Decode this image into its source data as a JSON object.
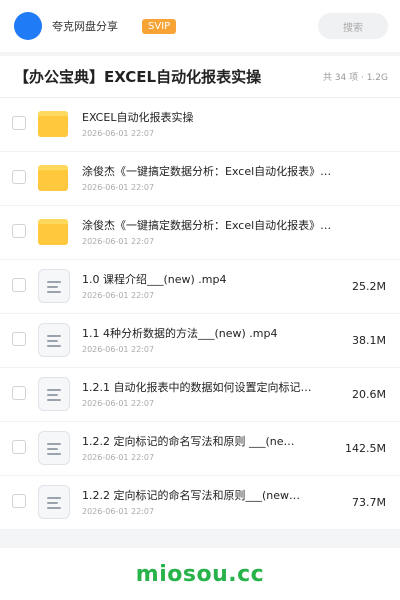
{
  "header": {
    "username": "夸克网盘分享",
    "badge": "SVIP",
    "search_placeholder": "搜索",
    "accent_color": "#1f7cf6"
  },
  "folder": {
    "title": "【办公宝典】EXCEL自动化报表实操",
    "meta": "共 34 项 · 1.2G"
  },
  "items": [
    {
      "type": "folder",
      "icon": "folder-icon",
      "name": "EXCEL自动化报表实操",
      "date": "2026-06-01 22:07",
      "size": ""
    },
    {
      "type": "folder",
      "icon": "folder-icon",
      "name": "涂俊杰《一键搞定数据分析：Excel自动化报表》资料",
      "date": "2026-06-01 22:07",
      "size": ""
    },
    {
      "type": "folder",
      "icon": "folder-icon",
      "name": "涂俊杰《一键搞定数据分析：Excel自动化报表》资料",
      "date": "2026-06-01 22:07",
      "size": ""
    },
    {
      "type": "file",
      "icon": "document-icon",
      "name": "1.0 课程介绍___(new) .mp4",
      "date": "2026-06-01 22:07",
      "size": "25.2M"
    },
    {
      "type": "file",
      "icon": "document-icon",
      "name": "1.1 4种分析数据的方法___(new) .mp4",
      "date": "2026-06-01 22:07",
      "size": "38.1M"
    },
    {
      "type": "file",
      "icon": "document-icon",
      "name": "1.2.1 自动化报表中的数据如何设置定向标记…",
      "date": "2026-06-01 22:07",
      "size": "20.6M"
    },
    {
      "type": "file",
      "icon": "document-icon",
      "name": "1.2.2 定向标记的命名写法和原则 ___(ne…",
      "date": "2026-06-01 22:07",
      "size": "142.5M"
    },
    {
      "type": "file",
      "icon": "document-icon",
      "name": "1.2.2 定向标记的命名写法和原则___(new…",
      "date": "2026-06-01 22:07",
      "size": "73.7M"
    }
  ],
  "footer": {
    "watermark": "miosou.cc",
    "watermark_color": "#27b24a"
  }
}
